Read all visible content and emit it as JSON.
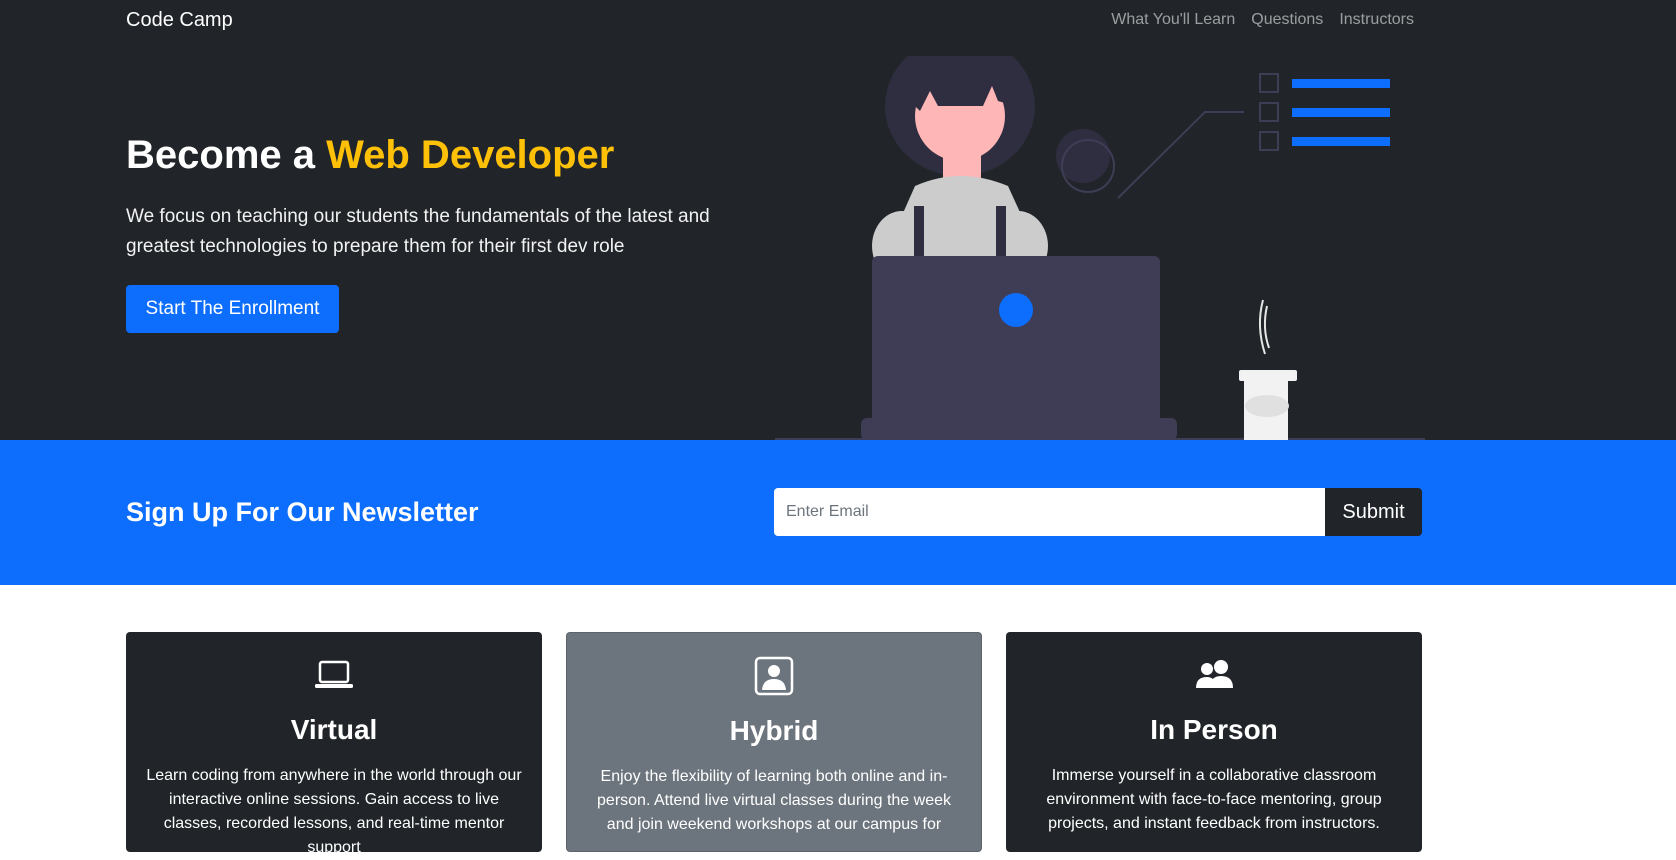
{
  "nav": {
    "brand": "Code Camp",
    "links": [
      "What You'll Learn",
      "Questions",
      "Instructors"
    ]
  },
  "hero": {
    "title_prefix": "Become a ",
    "title_accent": "Web Developer",
    "text": "We focus on teaching our students the fundamentals of the latest and greatest technologies to prepare them for their first dev role",
    "button_label": "Start The Enrollment"
  },
  "newsletter": {
    "title": "Sign Up For Our Newsletter",
    "placeholder": "Enter Email",
    "submit_label": "Submit"
  },
  "cards": [
    {
      "icon": "laptop-icon",
      "title": "Virtual",
      "text": "Learn coding from anywhere in the world through our interactive online sessions. Gain access to live classes, recorded lessons, and real-time mentor support"
    },
    {
      "icon": "person-badge-icon",
      "title": "Hybrid",
      "text": "Enjoy the flexibility of learning both online and in-person. Attend live virtual classes during the week and join weekend workshops at our campus for"
    },
    {
      "icon": "people-icon",
      "title": "In Person",
      "text": "Immerse yourself in a collaborative classroom environment with face-to-face mentoring, group projects, and instant feedback from instructors."
    }
  ],
  "colors": {
    "dark": "#212529",
    "primary": "#0d6efd",
    "accent": "#ffc107",
    "secondary": "#6c757d"
  }
}
